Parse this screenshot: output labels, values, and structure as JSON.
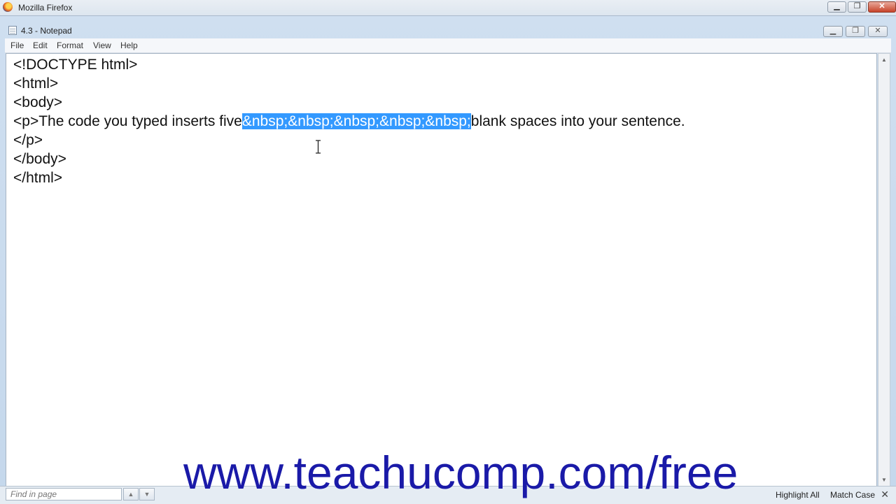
{
  "browser": {
    "title": "Mozilla Firefox"
  },
  "notepad": {
    "title": "4.3 - Notepad",
    "menu": [
      "File",
      "Edit",
      "Format",
      "View",
      "Help"
    ]
  },
  "editor": {
    "lines": [
      "<!DOCTYPE html>",
      "<html>",
      "<body>",
      "<p>The code you typed inserts five&nbsp;&nbsp;&nbsp;&nbsp;&nbsp;blank spaces into your sentence.",
      "</p>",
      "</body>",
      "</html>"
    ],
    "line4_before": "<p>The code you typed inserts five",
    "line4_selected": "&nbsp;&nbsp;&nbsp;&nbsp;&nbsp;",
    "line4_after": "blank spaces into your sentence."
  },
  "watermark": "www.teachucomp.com/free",
  "findbar": {
    "placeholder": "Find in page",
    "highlight_all": "Highlight All",
    "match_case": "Match Case"
  },
  "colors": {
    "selection": "#3399ff",
    "watermark": "#1a1aa8"
  }
}
